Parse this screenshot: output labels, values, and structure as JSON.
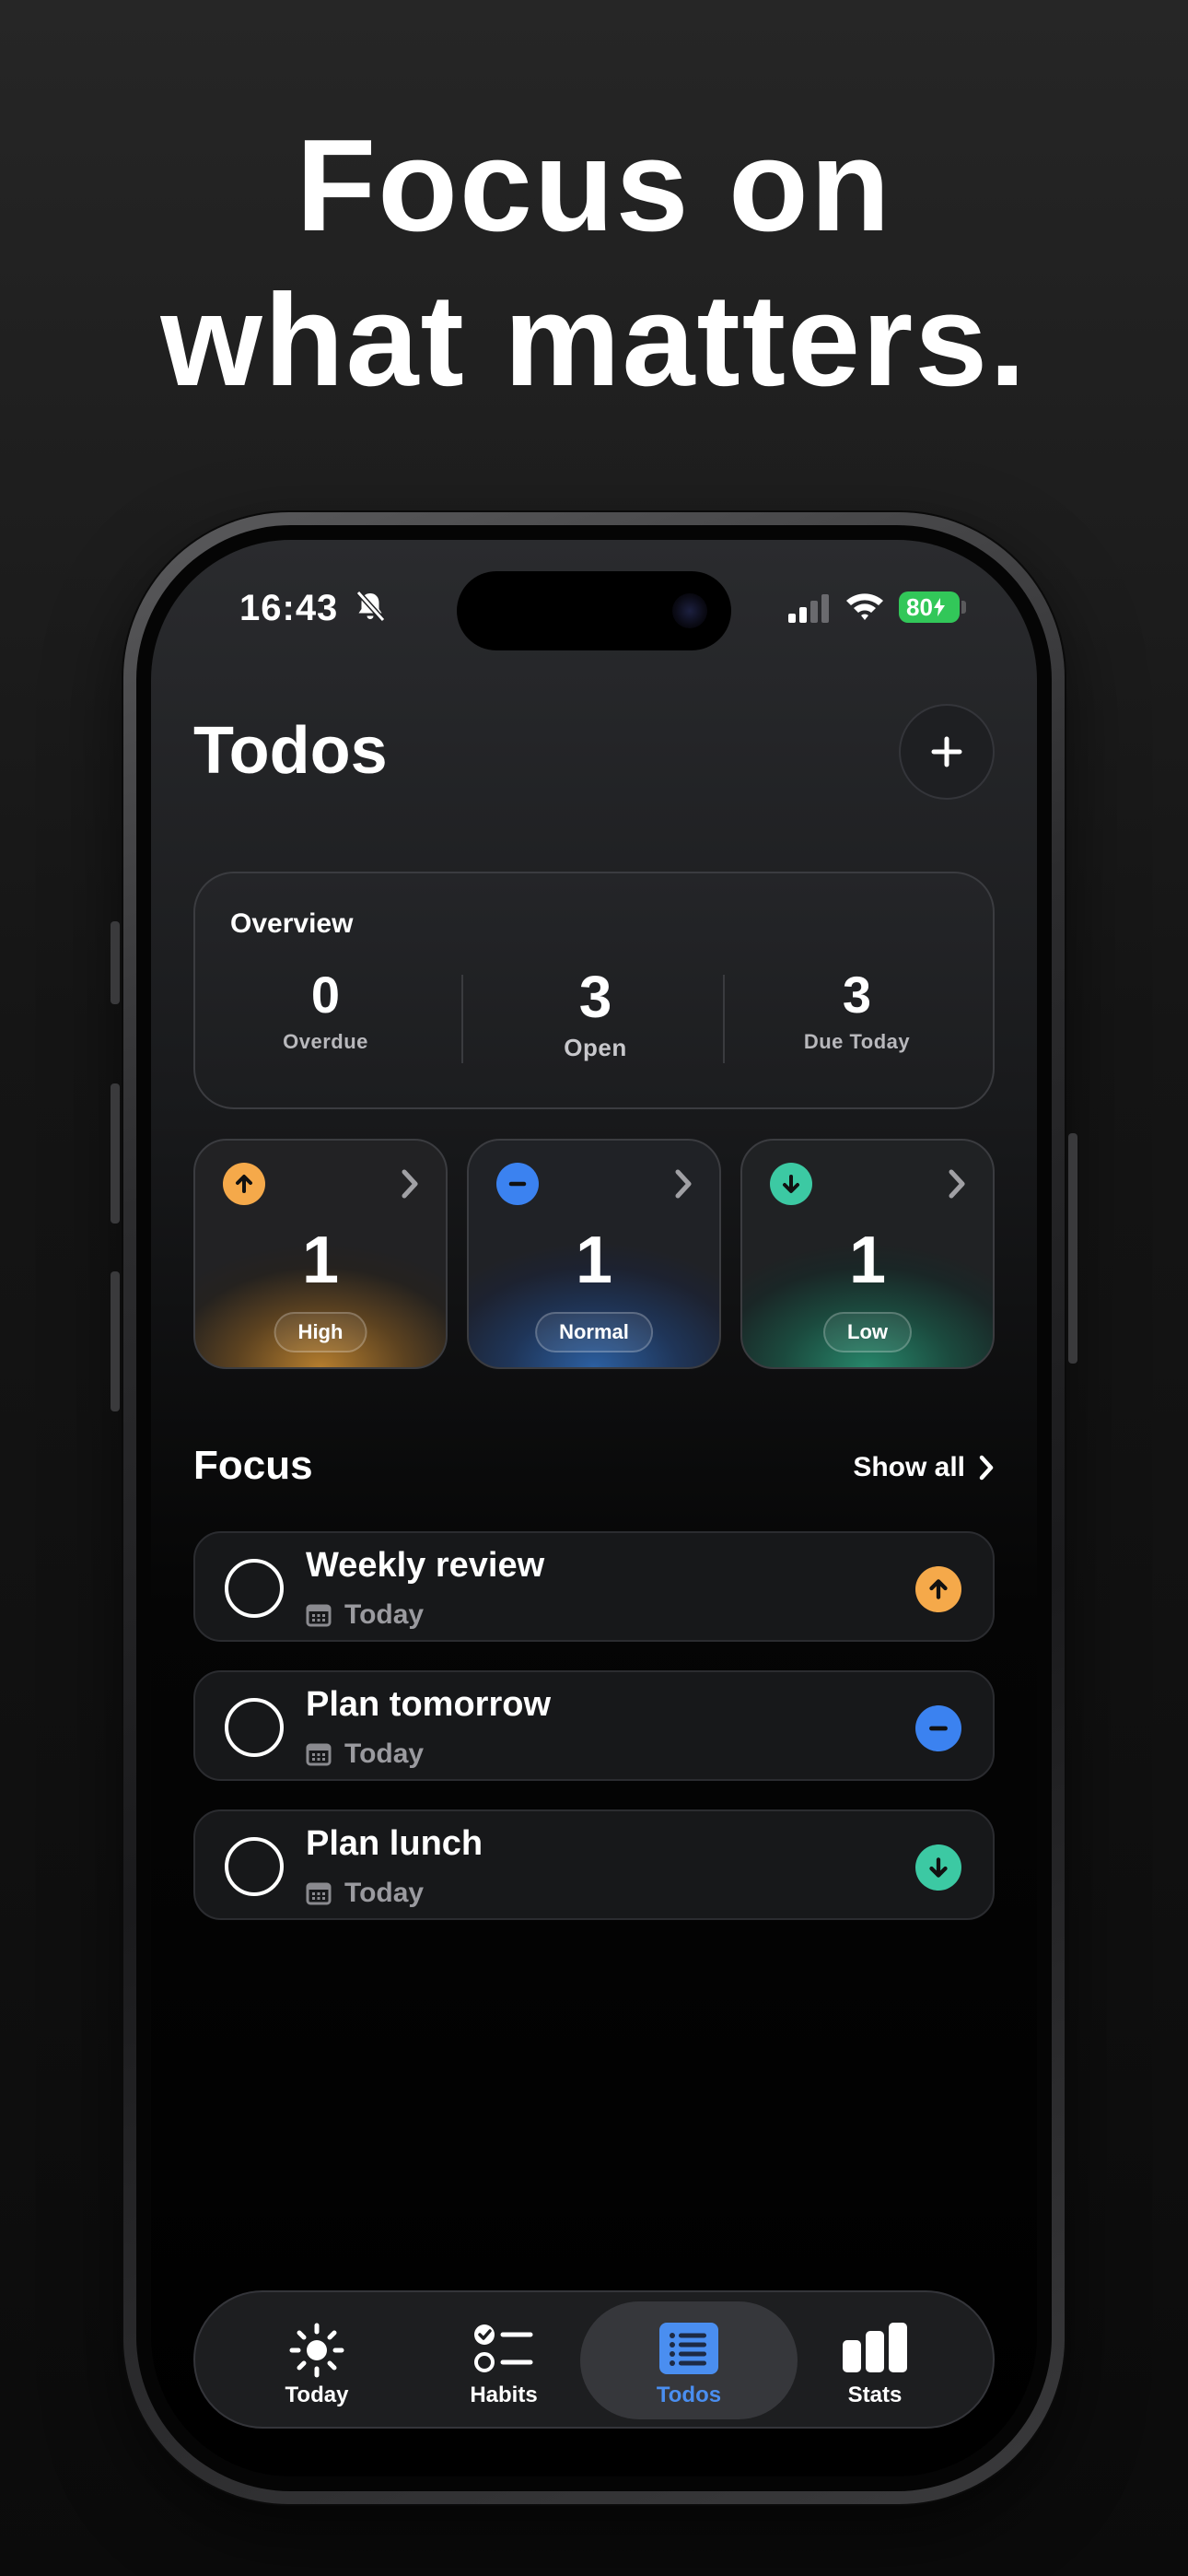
{
  "headline": {
    "line1": "Focus on",
    "line2": "what matters."
  },
  "status_bar": {
    "time": "16:43",
    "battery": "80"
  },
  "header": {
    "title": "Todos"
  },
  "overview": {
    "title": "Overview",
    "stats": [
      {
        "value": "0",
        "label": "Overdue"
      },
      {
        "value": "3",
        "label": "Open"
      },
      {
        "value": "3",
        "label": "Due Today"
      }
    ]
  },
  "priorities": [
    {
      "count": "1",
      "label": "High",
      "color": "#f5a94a",
      "icon": "arrow-up-icon"
    },
    {
      "count": "1",
      "label": "Normal",
      "color": "#3b82f0",
      "icon": "minus-icon"
    },
    {
      "count": "1",
      "label": "Low",
      "color": "#3cc9a3",
      "icon": "arrow-down-icon"
    }
  ],
  "focus": {
    "title": "Focus",
    "show_all": "Show all",
    "items": [
      {
        "title": "Weekly review",
        "date": "Today",
        "priority": "High"
      },
      {
        "title": "Plan tomorrow",
        "date": "Today",
        "priority": "Normal"
      },
      {
        "title": "Plan lunch",
        "date": "Today",
        "priority": "Low"
      }
    ]
  },
  "tabs": [
    {
      "label": "Today",
      "icon": "sun-icon"
    },
    {
      "label": "Habits",
      "icon": "checklist-icon"
    },
    {
      "label": "Todos",
      "icon": "list-icon",
      "active": true
    },
    {
      "label": "Stats",
      "icon": "bar-chart-icon"
    }
  ]
}
